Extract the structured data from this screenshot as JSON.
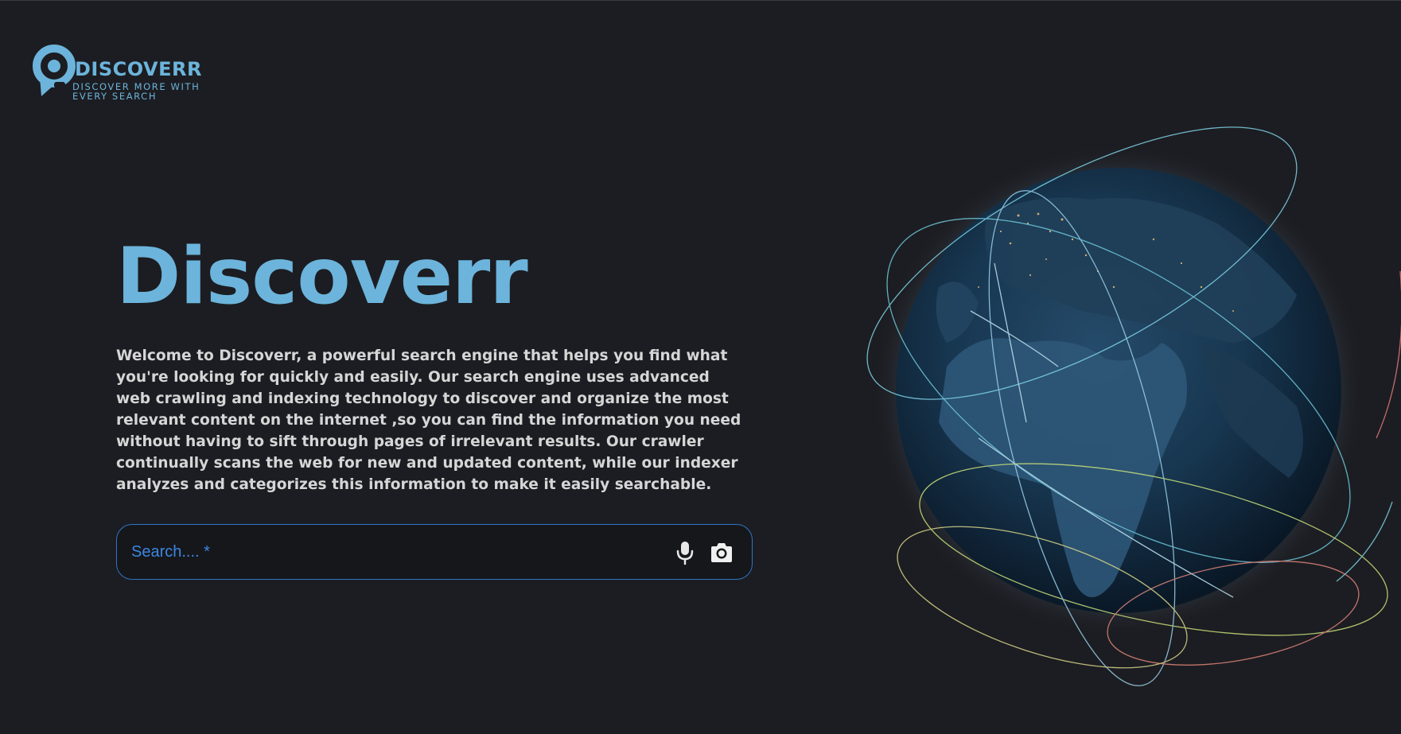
{
  "logo": {
    "icon": "location-pin-search-icon",
    "name": "DISCOVERR",
    "tagline": "DISCOVER MORE WITH EVERY SEARCH"
  },
  "hero": {
    "title": "Discoverr",
    "description": "Welcome to Discoverr, a powerful search engine that helps you find what you're looking for quickly and easily. Our search engine uses advanced web crawling and indexing technology to discover and organize the most relevant content on the internet ,so you can find the information you need without having to sift through pages of irrelevant results. Our crawler continually scans the web for new and updated content, while our indexer analyzes and categorizes this information to make it easily searchable."
  },
  "search": {
    "placeholder": "Search.... *",
    "value": "",
    "mic_icon": "microphone-icon",
    "camera_icon": "camera-icon"
  },
  "visual": {
    "globe_icon": "earth-globe-illustration"
  },
  "colors": {
    "background": "#1c1d22",
    "accent": "#6cb4db",
    "search_border": "#2f74c4",
    "placeholder": "#3d86e0",
    "body_text": "#d6d6d6"
  }
}
